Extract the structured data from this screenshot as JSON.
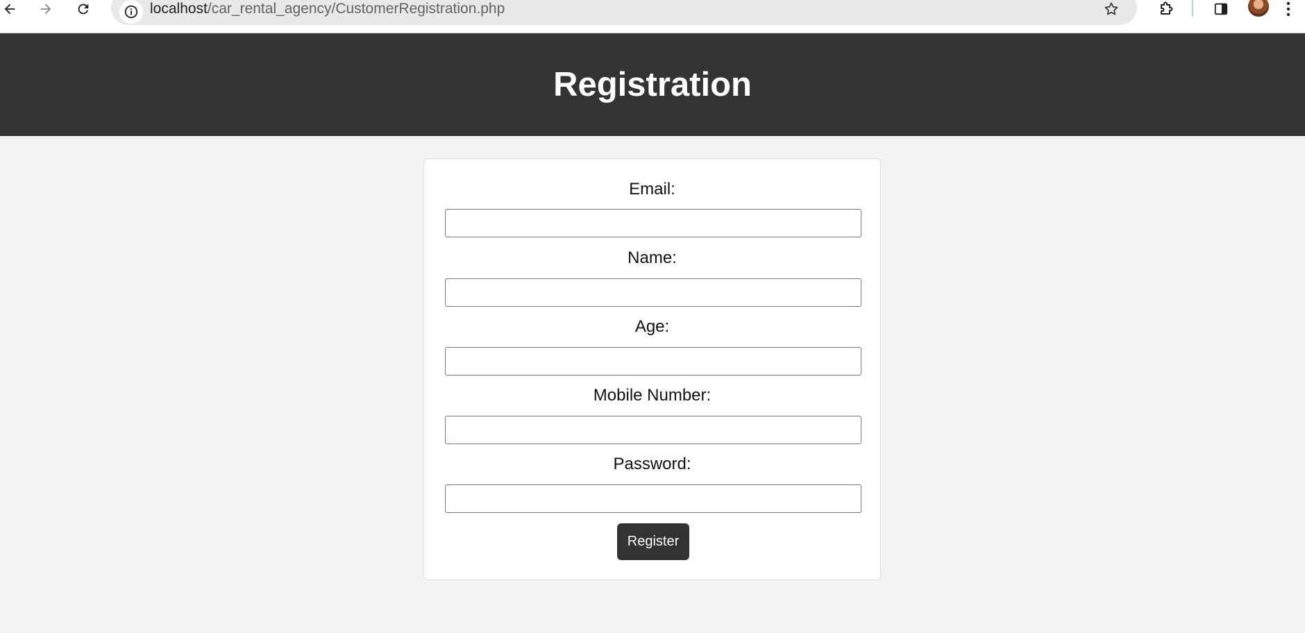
{
  "browser": {
    "url_host": "localhost",
    "url_path": "/car_rental_agency/CustomerRegistration.php",
    "icons": [
      "back-icon",
      "forward-icon",
      "reload-icon",
      "site-info-icon",
      "bookmark-star-icon",
      "extensions-icon",
      "side-panel-icon",
      "profile-avatar",
      "more-menu-icon"
    ]
  },
  "header": {
    "title": "Registration",
    "background": "#333333",
    "text_color": "#ffffff"
  },
  "form": {
    "fields": [
      {
        "label": "Email:",
        "value": "",
        "type": "email"
      },
      {
        "label": "Name:",
        "value": "",
        "type": "text"
      },
      {
        "label": "Age:",
        "value": "",
        "type": "text"
      },
      {
        "label": "Mobile Number:",
        "value": "",
        "type": "text"
      },
      {
        "label": "Password:",
        "value": "",
        "type": "password"
      }
    ],
    "submit_label": "Register",
    "button_color": "#333333"
  },
  "page": {
    "background": "#f3f3f3"
  }
}
